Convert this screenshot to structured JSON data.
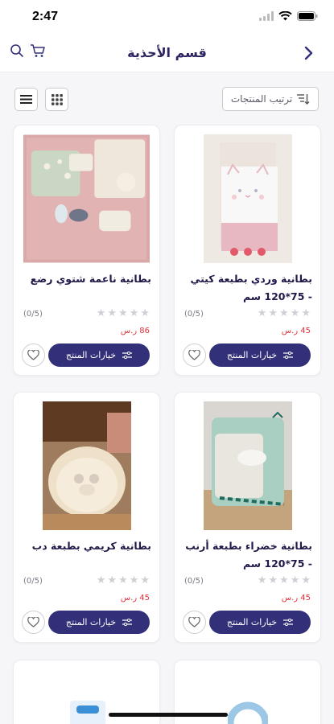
{
  "status_bar": {
    "time": "2:47"
  },
  "header": {
    "title": "قسم الأحذية"
  },
  "toolbar": {
    "sort_label": "ترتيب المنتجات"
  },
  "colors": {
    "primary": "#33307a",
    "price": "#e0323c",
    "star_empty": "#cfcfd6"
  },
  "products": [
    {
      "name": "بطانية وردي بطبعة كيتي - 75*120 سم",
      "rating": "(0/5)",
      "price": "45 ر.س",
      "options_label": "خيارات المنتج"
    },
    {
      "name": "بطانية ناعمة شتوي رضع",
      "rating": "(0/5)",
      "price": "86 ر.س",
      "options_label": "خيارات المنتج"
    },
    {
      "name": "بطانية خضراء بطبعة أرنب - 75*120 سم",
      "rating": "(0/5)",
      "price": "45 ر.س",
      "options_label": "خيارات المنتج"
    },
    {
      "name": "بطانية كريمي بطبعة دب",
      "rating": "(0/5)",
      "price": "45 ر.س",
      "options_label": "خيارات المنتج"
    }
  ]
}
